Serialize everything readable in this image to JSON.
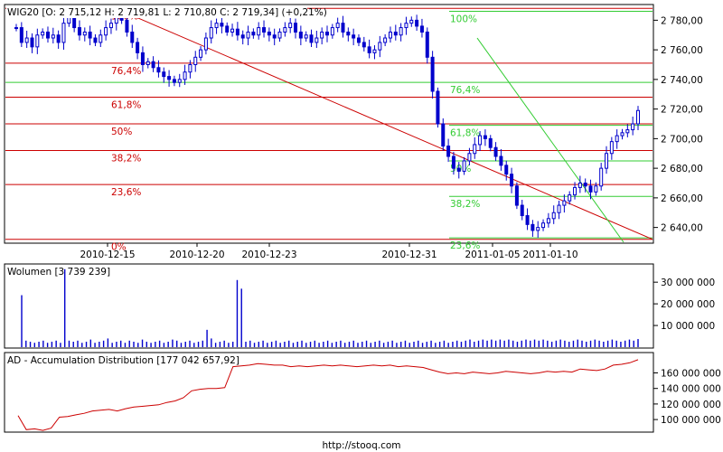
{
  "chart_data": [
    {
      "type": "candlestick",
      "title": "WIG20 [O: 2 715,12  H: 2 719,81  L: 2 710,80  C: 2 719,34] (+0,21%)",
      "ylim": [
        2630,
        2790
      ],
      "yticks": [
        "2 780,00",
        "2 760,00",
        "2 740,00",
        "2 720,00",
        "2 700,00",
        "2 680,00",
        "2 660,00",
        "2 640,00"
      ],
      "yticks_values": [
        2780,
        2760,
        2740,
        2720,
        2700,
        2680,
        2660,
        2640
      ],
      "xticks": [
        "2010-12-15",
        "2010-12-20",
        "2010-12-23",
        "2010-12-31",
        "2011-01-05",
        "2011-01-10"
      ],
      "grid": false,
      "fib_red": {
        "labels": [
          "100%",
          "76,4%",
          "61,8%",
          "50%",
          "38,2%",
          "23,6%",
          "0%"
        ],
        "values": [
          2788,
          2751,
          2728,
          2710,
          2692,
          2669,
          2632
        ]
      },
      "fib_green": {
        "labels": [
          "100%",
          "76,4%",
          "61,8%",
          "50%",
          "38,2%",
          "23,6%"
        ],
        "values": [
          2786,
          2738,
          2709,
          2685,
          2661,
          2633
        ]
      },
      "close_series": [
        2775,
        2765,
        2768,
        2762,
        2770,
        2772,
        2768,
        2770,
        2765,
        2778,
        2782,
        2775,
        2770,
        2772,
        2768,
        2765,
        2770,
        2775,
        2778,
        2783,
        2780,
        2772,
        2765,
        2758,
        2750,
        2752,
        2748,
        2745,
        2742,
        2740,
        2738,
        2740,
        2745,
        2750,
        2755,
        2760,
        2768,
        2775,
        2778,
        2776,
        2772,
        2774,
        2770,
        2768,
        2772,
        2770,
        2775,
        2772,
        2770,
        2768,
        2772,
        2775,
        2778,
        2772,
        2768,
        2770,
        2765,
        2768,
        2772,
        2770,
        2775,
        2778,
        2772,
        2770,
        2768,
        2765,
        2762,
        2758,
        2760,
        2765,
        2768,
        2772,
        2770,
        2775,
        2778,
        2780,
        2776,
        2772,
        2755,
        2732,
        2710,
        2695,
        2688,
        2680,
        2678,
        2685,
        2690,
        2696,
        2702,
        2700,
        2694,
        2688,
        2682,
        2676,
        2668,
        2655,
        2648,
        2642,
        2638,
        2640,
        2643,
        2646,
        2650,
        2655,
        2658,
        2662,
        2667,
        2670,
        2668,
        2664,
        2668,
        2680,
        2690,
        2698,
        2702,
        2704,
        2706,
        2710,
        2719
      ]
    },
    {
      "type": "bar",
      "title": "Wolumen [3 739 239]",
      "ylim": [
        0,
        38000000
      ],
      "yticks": [
        "30 000 000",
        "20 000 000",
        "10 000 000"
      ],
      "yticks_values": [
        30000000,
        20000000,
        10000000
      ],
      "values": [
        24000000,
        3000000,
        2500000,
        2000000,
        2500000,
        3000000,
        2000000,
        2500000,
        3000000,
        2000000,
        36000000,
        3000000,
        2500000,
        3000000,
        2000000,
        2500000,
        3500000,
        2000000,
        2500000,
        3000000,
        4000000,
        2000000,
        2500000,
        3000000,
        2000000,
        3000000,
        2500000,
        2000000,
        3500000,
        2500000,
        2000000,
        2500000,
        3000000,
        2000000,
        2500000,
        3500000,
        3000000,
        2000000,
        2500000,
        3000000,
        2000000,
        2500000,
        3000000,
        8000000,
        4000000,
        2000000,
        2500000,
        3000000,
        2000000,
        2500000,
        31000000,
        27000000,
        2500000,
        3000000,
        2000000,
        2500000,
        3000000,
        2000000,
        2500000,
        3000000,
        2000000,
        2500000,
        3000000,
        2000000,
        2500000,
        3000000,
        2000000,
        2500000,
        3000000,
        2000000,
        2500000,
        3000000,
        2000000,
        2500000,
        3000000,
        2000000,
        2500000,
        3000000,
        2000000,
        2500000,
        3000000,
        2000000,
        2500000,
        3000000,
        2000000,
        2500000,
        3000000,
        2000000,
        2500000,
        3000000,
        2000000,
        2500000,
        3000000,
        2000000,
        2500000,
        3000000,
        2000000,
        2500000,
        3000000,
        2000000,
        2500000,
        3000000,
        2500000,
        3000000,
        3500000,
        2500000,
        3000000,
        3500000,
        3000000,
        3500000,
        3000000,
        3500000,
        3000000,
        3500000,
        3000000,
        2500000,
        3000000,
        3500000,
        3000000,
        3500000,
        3000000,
        3500000,
        3000000,
        2500000,
        3000000,
        3500000,
        3000000,
        2500000,
        3000000,
        3500000,
        3000000,
        2500000,
        3000000,
        3500000,
        3000000,
        2500000,
        3000000,
        3500000,
        3000000,
        2500000,
        3000000,
        3500000,
        3000000,
        3739239
      ]
    },
    {
      "type": "line",
      "title": "AD - Accumulation Distribution [177 042 657,92]",
      "ylim": [
        85000000,
        185000000
      ],
      "yticks": [
        "160 000 000",
        "140 000 000",
        "120 000 000",
        "100 000 000"
      ],
      "yticks_values": [
        160000000,
        140000000,
        120000000,
        100000000
      ],
      "values": [
        105000000,
        87000000,
        88000000,
        86000000,
        89000000,
        103000000,
        104000000,
        106000000,
        108000000,
        111000000,
        112000000,
        113000000,
        111000000,
        114000000,
        116000000,
        117000000,
        118000000,
        119000000,
        122000000,
        124000000,
        128000000,
        137000000,
        139000000,
        140000000,
        140000000,
        141000000,
        168000000,
        169000000,
        170000000,
        172000000,
        171000000,
        170000000,
        170000000,
        168000000,
        169000000,
        168000000,
        169000000,
        170000000,
        169000000,
        170000000,
        169000000,
        168000000,
        169000000,
        170000000,
        169000000,
        170000000,
        168000000,
        169000000,
        168000000,
        167000000,
        164000000,
        161000000,
        159000000,
        160000000,
        159000000,
        161000000,
        160000000,
        159000000,
        160000000,
        162000000,
        161000000,
        160000000,
        159000000,
        160000000,
        162000000,
        161000000,
        162000000,
        161000000,
        165000000,
        164000000,
        163000000,
        165000000,
        170000000,
        171000000,
        173000000,
        177000000
      ]
    }
  ],
  "footer": {
    "url": "http://stooq.com"
  },
  "colors": {
    "candle": "#0000cc",
    "fib_red": "#cc0000",
    "fib_green": "#33cc33",
    "label_red": "#cc0000",
    "label_green": "#33cc33",
    "ad_line": "#cc0000",
    "volume": "#0000cc",
    "frame": "#000000"
  }
}
